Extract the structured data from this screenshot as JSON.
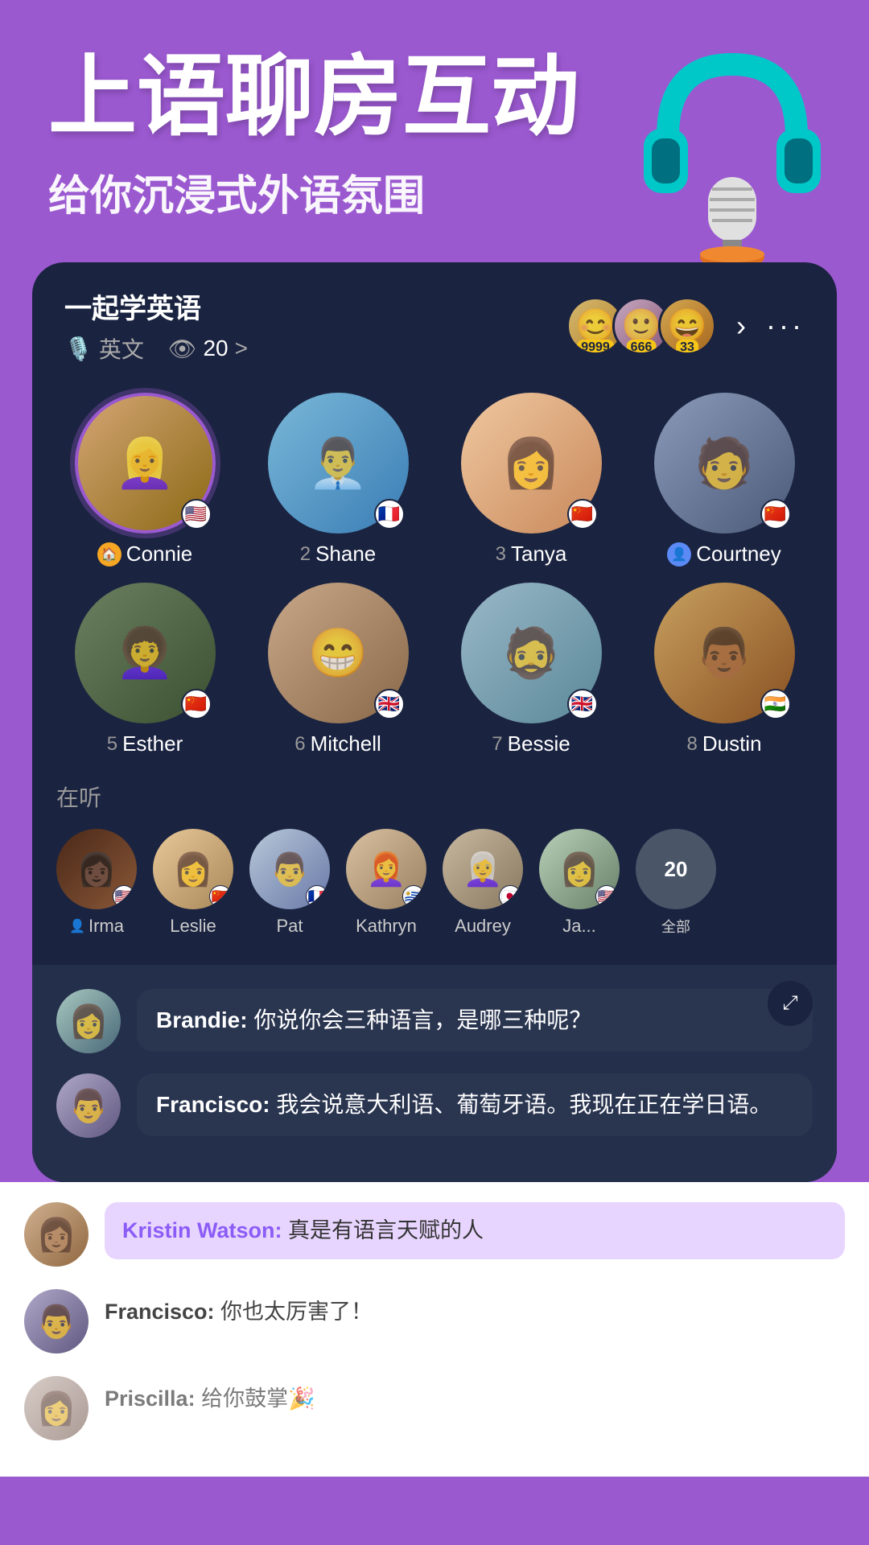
{
  "header": {
    "main_title": "上语聊房互动",
    "sub_title": "给你沉浸式外语氛围"
  },
  "room": {
    "name": "一起学英语",
    "language": "英文",
    "viewers": "20",
    "viewers_arrow": ">",
    "avatar_counts": [
      "9999",
      "666",
      "33"
    ],
    "more_label": "···"
  },
  "speakers": [
    {
      "num": "",
      "name": "Connie",
      "flag": "🇺🇸",
      "is_host": true,
      "role_icon": "🏠"
    },
    {
      "num": "2",
      "name": "Shane",
      "flag": "🇫🇷",
      "is_host": false
    },
    {
      "num": "3",
      "name": "Tanya",
      "flag": "🇨🇳",
      "is_host": false
    },
    {
      "num": "",
      "name": "Courtney",
      "flag": "🇨🇳",
      "is_host": false,
      "role_icon": "👤"
    },
    {
      "num": "5",
      "name": "Esther",
      "flag": "🇨🇳",
      "is_host": false
    },
    {
      "num": "6",
      "name": "Mitchell",
      "flag": "🇬🇧",
      "is_host": false
    },
    {
      "num": "7",
      "name": "Bessie",
      "flag": "🇬🇧",
      "is_host": false
    },
    {
      "num": "8",
      "name": "Dustin",
      "flag": "🇮🇳",
      "is_host": false
    }
  ],
  "listeners": {
    "title": "在听",
    "users": [
      {
        "name": "Irma",
        "flag": "🇺🇸",
        "role_icon": "👤"
      },
      {
        "name": "Leslie",
        "flag": "🇨🇳"
      },
      {
        "name": "Pat",
        "flag": "🇫🇷"
      },
      {
        "name": "Kathryn",
        "flag": "🇺🇾"
      },
      {
        "name": "Audrey",
        "flag": "🇯🇵"
      },
      {
        "name": "Ja...",
        "flag": "🇺🇸"
      }
    ],
    "more_count": "20",
    "more_label": "全部"
  },
  "chat": {
    "expand_icon": "⤢",
    "messages": [
      {
        "sender": "Brandie",
        "text": "你说你会三种语言，是哪三种呢？"
      },
      {
        "sender": "Francisco",
        "text": "我会说意大利语、葡萄牙语。我现在正在学日语。"
      }
    ]
  },
  "bottom_chat": {
    "messages": [
      {
        "sender": "Kristin Watson",
        "text": "真是有语言天赋的人",
        "highlighted": true
      },
      {
        "sender": "Francisco",
        "text": "你也太厉害了！",
        "highlighted": false
      },
      {
        "sender": "Priscilla",
        "text": "给你鼓掌🎉",
        "highlighted": false,
        "partial": true
      }
    ]
  }
}
